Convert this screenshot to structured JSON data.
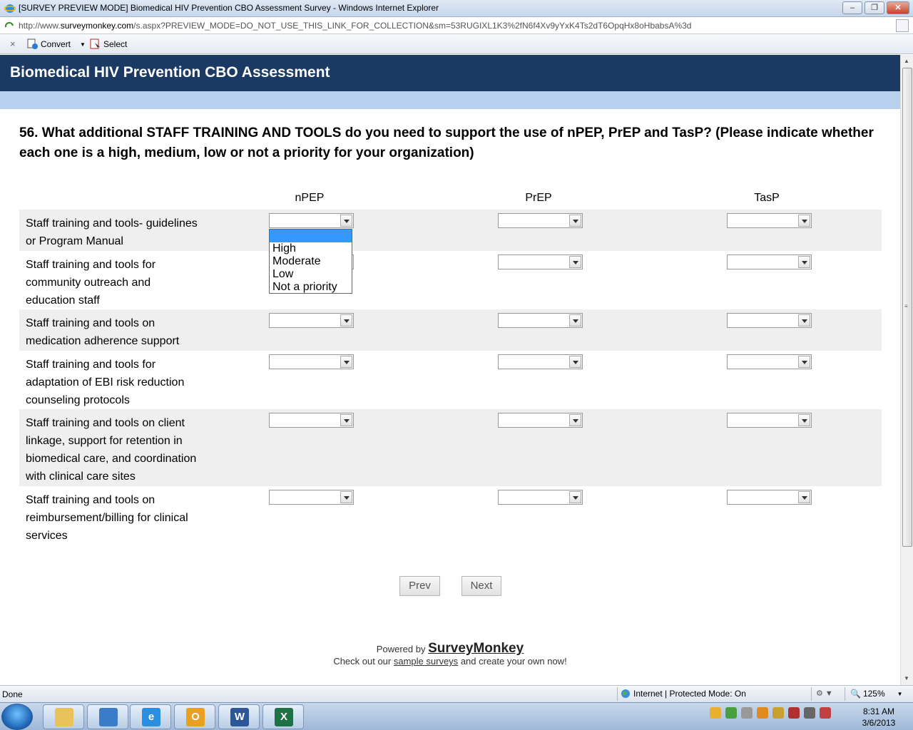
{
  "window": {
    "title": "[SURVEY PREVIEW MODE] Biomedical HIV Prevention CBO Assessment Survey - Windows Internet Explorer",
    "url_prefix": "http://www.",
    "url_domain": "surveymonkey.com",
    "url_rest": "/s.aspx?PREVIEW_MODE=DO_NOT_USE_THIS_LINK_FOR_COLLECTION&sm=53RUGIXL1K3%2fN6f4Xv9yYxK4Ts2dT6OpqHx8oHbabsA%3d"
  },
  "toolbar": {
    "convert_label": "Convert",
    "select_label": "Select"
  },
  "survey": {
    "header_title": "Biomedical HIV Prevention CBO Assessment",
    "question": "56. What additional STAFF TRAINING AND TOOLS do you need to support the use of nPEP, PrEP and TasP? (Please indicate whether each one is a high, medium, low or not a priority for your organization)",
    "columns": [
      "nPEP",
      "PrEP",
      "TasP"
    ],
    "rows": [
      {
        "label": "Staff training and tools- guidelines or Program Manual"
      },
      {
        "label": "Staff training and tools for community outreach and education staff"
      },
      {
        "label": "Staff training and tools on medication adherence support"
      },
      {
        "label": "Staff training and tools for adaptation of EBI risk reduction counseling protocols"
      },
      {
        "label": "Staff training and tools on client linkage, support for retention in biomedical care, and coordination with clinical care sites"
      },
      {
        "label": "Staff training and tools on reimbursement/billing for clinical services"
      }
    ],
    "open_dropdown_options": [
      "",
      "High",
      "Moderate",
      "Low",
      "Not a priority"
    ],
    "prev_label": "Prev",
    "next_label": "Next",
    "powered_by": "Powered by",
    "brand": "SurveyMonkey",
    "checkout_pre": "Check out our",
    "checkout_link": "sample surveys",
    "checkout_post": "and create your own now!"
  },
  "statusbar": {
    "status": "Done",
    "zone": "Internet | Protected Mode: On",
    "zoom": "125%"
  },
  "taskbar": {
    "time": "8:31 AM",
    "date": "3/6/2013"
  },
  "colors": {
    "header_bg": "#1a3a64",
    "subheader_bg": "#b8d0ee",
    "row_shade": "#efefef",
    "selection": "#3399ff"
  }
}
